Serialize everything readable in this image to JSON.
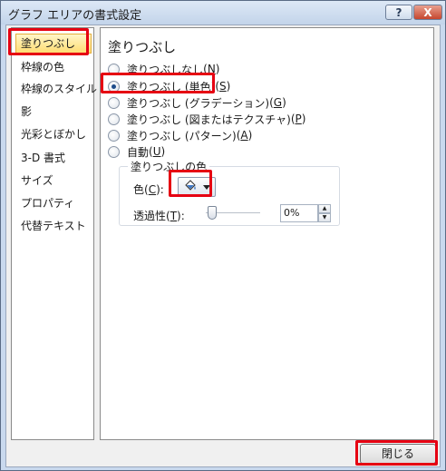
{
  "window": {
    "title": "グラフ エリアの書式設定",
    "help_label": "?",
    "close_label": "X"
  },
  "nav": {
    "items": [
      {
        "label": "塗りつぶし",
        "selected": true
      },
      {
        "label": "枠線の色"
      },
      {
        "label": "枠線のスタイル"
      },
      {
        "label": "影"
      },
      {
        "label": "光彩とぼかし"
      },
      {
        "label": "3-D 書式"
      },
      {
        "label": "サイズ"
      },
      {
        "label": "プロパティ"
      },
      {
        "label": "代替テキスト"
      }
    ]
  },
  "content": {
    "title": "塗りつぶし",
    "options": [
      {
        "text": "塗りつぶしなし",
        "key": "N",
        "checked": false
      },
      {
        "text": "塗りつぶし (単色)",
        "key": "S",
        "checked": true
      },
      {
        "text": "塗りつぶし (グラデーション)",
        "key": "G",
        "checked": false
      },
      {
        "text": "塗りつぶし (図またはテクスチャ)",
        "key": "P",
        "checked": false
      },
      {
        "text": "塗りつぶし (パターン)",
        "key": "A",
        "checked": false
      },
      {
        "text": "自動",
        "key": "U",
        "checked": false
      }
    ],
    "fill_color_group": {
      "title": "塗りつぶしの色",
      "color_label": "色",
      "color_key": "C",
      "color_icon": "paint-bucket-icon",
      "transparency_label": "透過性",
      "transparency_key": "T",
      "transparency_value": "0%"
    }
  },
  "footer": {
    "close_button": "閉じる"
  },
  "colors": {
    "highlight": "#e60012",
    "selected_nav": "#ffdd73",
    "window_frame": "#c9d9ee"
  }
}
